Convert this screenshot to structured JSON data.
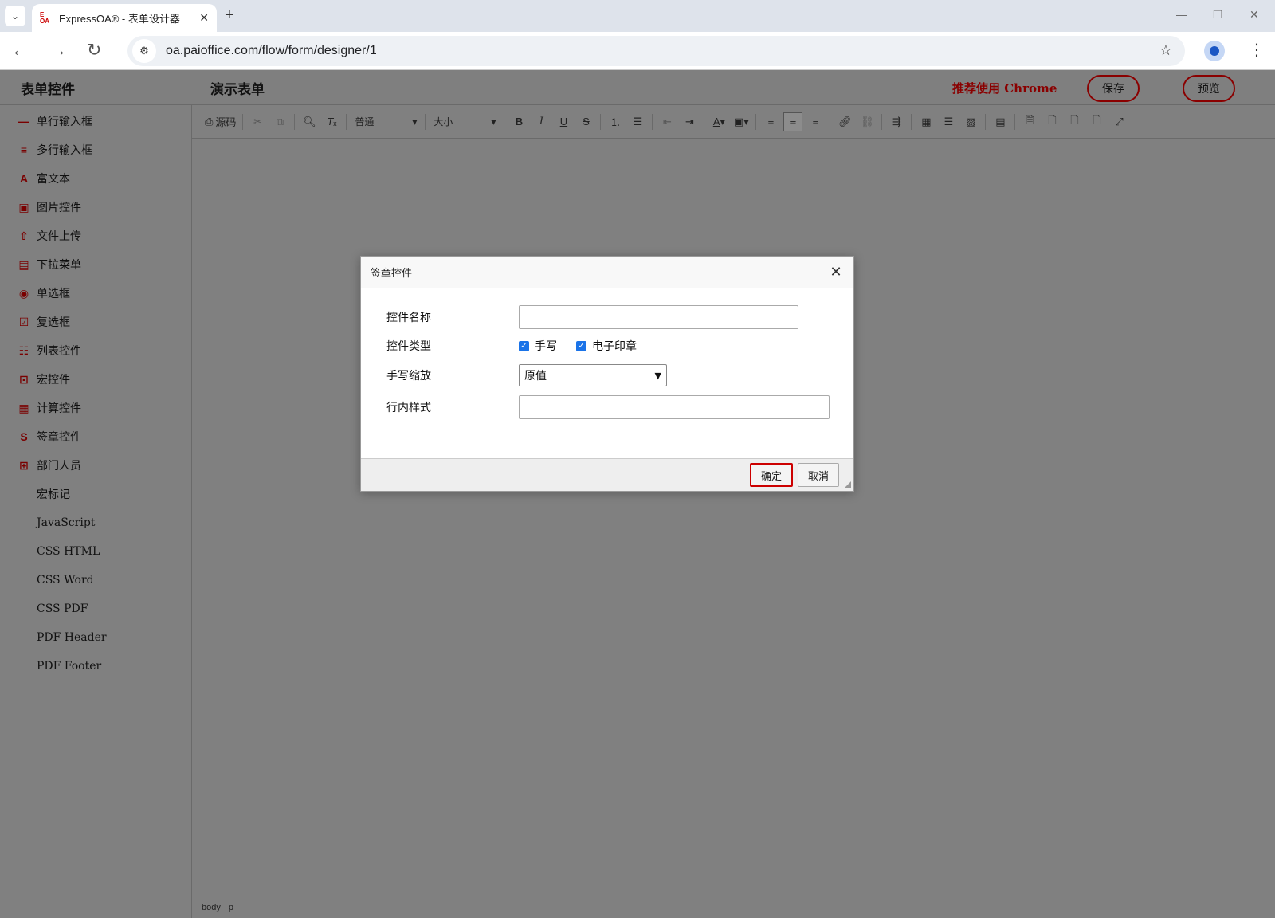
{
  "browser": {
    "tab_title": "ExpressOA® - 表单设计器",
    "favicon_text": "E OA",
    "url": "oa.paioffice.com/flow/form/designer/1"
  },
  "header": {
    "app_title": "表单控件",
    "form_title": "演示表单",
    "recommend": "推荐使用 Chrome",
    "save_label": "保存",
    "preview_label": "预览"
  },
  "sidebar": {
    "items": [
      {
        "label": "单行输入框",
        "icon": "single-line-icon"
      },
      {
        "label": "多行输入框",
        "icon": "multi-line-icon"
      },
      {
        "label": "富文本",
        "icon": "rich-text-icon"
      },
      {
        "label": "图片控件",
        "icon": "image-icon"
      },
      {
        "label": "文件上传",
        "icon": "file-upload-icon"
      },
      {
        "label": "下拉菜单",
        "icon": "dropdown-icon"
      },
      {
        "label": "单选框",
        "icon": "radio-icon"
      },
      {
        "label": "复选框",
        "icon": "checkbox-icon"
      },
      {
        "label": "列表控件",
        "icon": "list-icon"
      },
      {
        "label": "宏控件",
        "icon": "macro-icon"
      },
      {
        "label": "计算控件",
        "icon": "calculator-icon"
      },
      {
        "label": "签章控件",
        "icon": "signature-icon"
      },
      {
        "label": "部门人员",
        "icon": "department-icon"
      },
      {
        "label": "宏标记"
      },
      {
        "label": "JavaScript"
      },
      {
        "label": "CSS HTML"
      },
      {
        "label": "CSS Word"
      },
      {
        "label": "CSS PDF"
      },
      {
        "label": "PDF Header"
      },
      {
        "label": "PDF Footer"
      }
    ]
  },
  "toolbar": {
    "source_label": "源码",
    "format_value": "普通",
    "size_value": "大小"
  },
  "statusbar": {
    "path": [
      "body",
      "p"
    ]
  },
  "dialog": {
    "title": "签章控件",
    "fields": {
      "name_label": "控件名称",
      "name_value": "",
      "type_label": "控件类型",
      "type_options": [
        {
          "label": "手写",
          "checked": true
        },
        {
          "label": "电子印章",
          "checked": true
        }
      ],
      "scale_label": "手写缩放",
      "scale_value": "原值",
      "style_label": "行内样式",
      "style_value": ""
    },
    "ok_label": "确定",
    "cancel_label": "取消"
  },
  "colors": {
    "accent": "#8a0000",
    "overlay": "#808080",
    "checkbox": "#1a73e8"
  }
}
